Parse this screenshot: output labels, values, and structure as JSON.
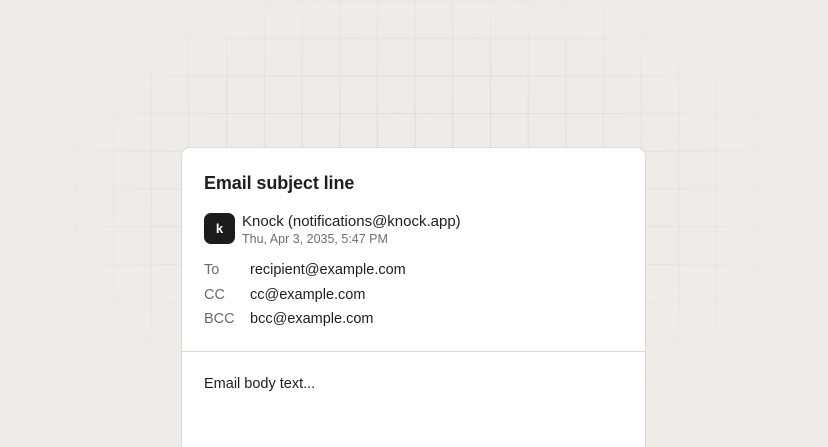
{
  "email": {
    "subject": "Email subject line",
    "sender": {
      "avatar_letter": "k",
      "name": "Knock (notifications@knock.app)",
      "date": "Thu, Apr 3, 2035, 5:47 PM"
    },
    "recipients": [
      {
        "label": "To",
        "value": "recipient@example.com"
      },
      {
        "label": "CC",
        "value": "cc@example.com"
      },
      {
        "label": "BCC",
        "value": "bcc@example.com"
      }
    ],
    "body": "Email body text..."
  },
  "colors": {
    "background": "#efece8",
    "card": "#ffffff",
    "avatar": "#1c1c1c",
    "text": "#1e1e1e",
    "muted": "#6f6f6f"
  }
}
